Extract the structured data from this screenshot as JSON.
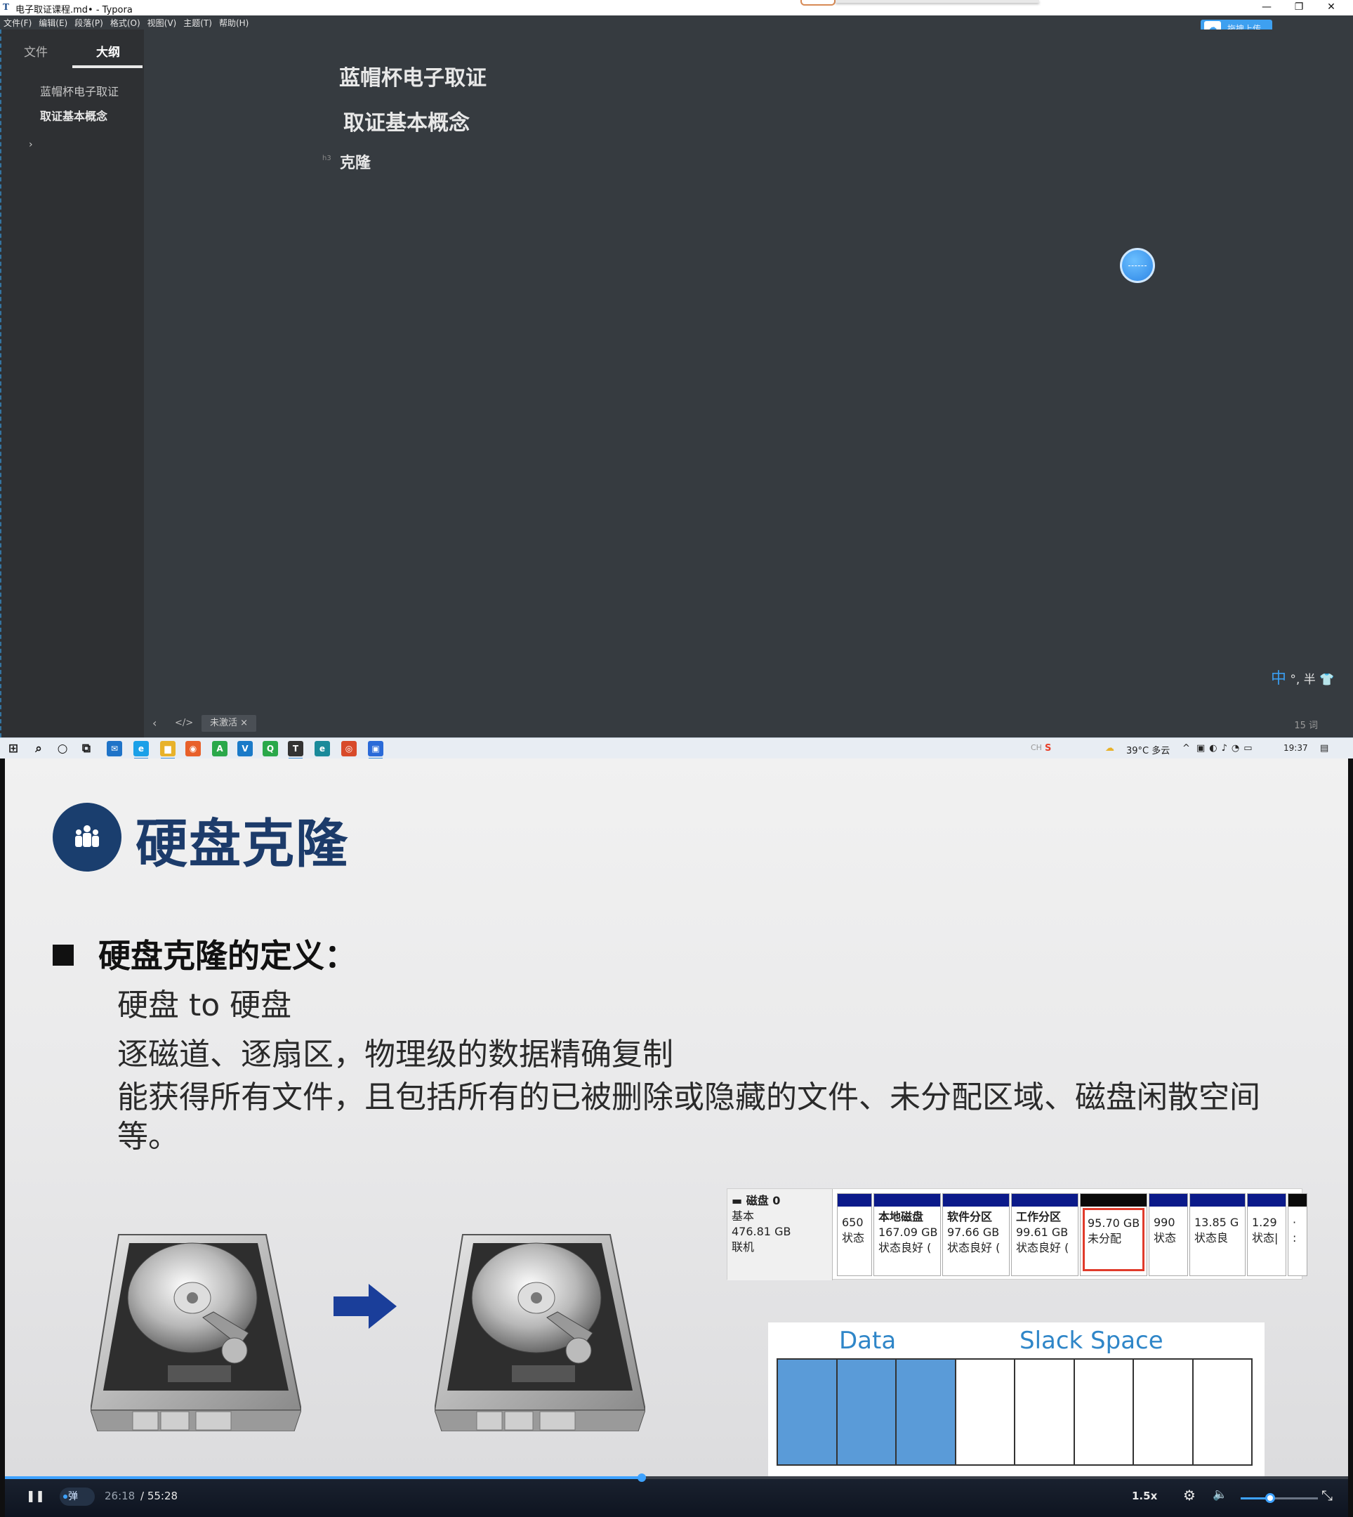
{
  "typora": {
    "window_title": "电子取证课程.md• - Typora",
    "controls": {
      "minimize": "—",
      "restore": "❐",
      "close": "✕"
    },
    "menu": [
      "文件(F)",
      "编辑(E)",
      "段落(P)",
      "格式(O)",
      "视图(V)",
      "主题(T)",
      "帮助(H)"
    ],
    "upload_label": "拖拽上传",
    "sidebar": {
      "tabs": [
        "文件",
        "大纲"
      ],
      "active_tab": "大纲",
      "outline": [
        "蓝帽杯电子取证",
        "取证基本概念"
      ],
      "expand_glyph": "›"
    },
    "editor": {
      "h1": "蓝帽杯电子取证",
      "h2": "取证基本概念",
      "h3": "克隆",
      "h3_marker": "h3"
    },
    "ime": {
      "mode": "中",
      "rest": "°, 半"
    },
    "statusbar": {
      "back_icon": "‹",
      "code_icon": "</>",
      "tag": "未激活 ×",
      "word_count": "15 词"
    }
  },
  "taskbar": {
    "apps": [
      {
        "name": "start",
        "glyph": "⊞",
        "color": "#1a1a1a"
      },
      {
        "name": "search",
        "glyph": "⌕",
        "color": "#1a1a1a"
      },
      {
        "name": "cortana",
        "glyph": "○",
        "color": "#1a1a1a"
      },
      {
        "name": "task-view",
        "glyph": "⧉",
        "color": "#1a1a1a"
      },
      {
        "name": "mail",
        "glyph": "✉",
        "color": "#1e73c8"
      },
      {
        "name": "edge-legacy",
        "glyph": "e",
        "color": "#1aa0e8"
      },
      {
        "name": "explorer",
        "glyph": "▆",
        "color": "#e8b22a"
      },
      {
        "name": "firefox",
        "glyph": "◉",
        "color": "#e8602a"
      },
      {
        "name": "app-a",
        "glyph": "A",
        "color": "#2aa84a"
      },
      {
        "name": "vmware",
        "glyph": "V",
        "color": "#1a7ac8"
      },
      {
        "name": "app-qc",
        "glyph": "Q",
        "color": "#2aa84a"
      },
      {
        "name": "typora",
        "glyph": "T",
        "color": "#333333"
      },
      {
        "name": "edge",
        "glyph": "e",
        "color": "#1a8a9a"
      },
      {
        "name": "chrome",
        "glyph": "◎",
        "color": "#d84a2a"
      },
      {
        "name": "player",
        "glyph": "▣",
        "color": "#2a6ad8"
      }
    ],
    "tray": {
      "weather": "39°C 多云",
      "time": "19:37",
      "lang_glyph": "CH",
      "sogou_glyph": "S"
    }
  },
  "slide": {
    "title": "硬盘克隆",
    "definition_heading": "硬盘克隆的定义：",
    "lines": [
      "硬盘 to 硬盘",
      "逐磁道、逐扇区，物理级的数据精确复制",
      "能获得所有文件，且包括所有的已被删除或隐藏的文件、未分配区域、磁盘闲散空间等。"
    ],
    "disk": {
      "name": "磁盘 0",
      "type": "基本",
      "size": "476.81 GB",
      "status": "联机",
      "partitions": [
        {
          "title": "",
          "line1": "650",
          "line2": "状态",
          "bar": "blue",
          "highlight": false
        },
        {
          "title": "本地磁盘",
          "line1": "167.09 GB",
          "line2": "状态良好 (",
          "bar": "blue",
          "highlight": false
        },
        {
          "title": "软件分区",
          "line1": "97.66 GB",
          "line2": "状态良好 (",
          "bar": "blue",
          "highlight": false
        },
        {
          "title": "工作分区",
          "line1": "99.61 GB",
          "line2": "状态良好 (",
          "bar": "blue",
          "highlight": false
        },
        {
          "title": "",
          "line1": "95.70 GB",
          "line2": "未分配",
          "bar": "black",
          "highlight": true
        },
        {
          "title": "",
          "line1": "990",
          "line2": "状态",
          "bar": "blue",
          "highlight": false
        },
        {
          "title": "",
          "line1": "13.85 G",
          "line2": "状态良",
          "bar": "blue",
          "highlight": false
        },
        {
          "title": "",
          "line1": "1.29",
          "line2": "状态|",
          "bar": "blue",
          "highlight": false
        },
        {
          "title": "",
          "line1": "·",
          "line2": ":",
          "bar": "black",
          "highlight": false
        }
      ]
    },
    "slack": {
      "data_label": "Data",
      "slack_label": "Slack Space",
      "filled_cells": 3,
      "total_cells": 8,
      "fill_color": "#5a9bd8"
    }
  },
  "player": {
    "play_pause_glyph": "❚❚",
    "danmu_label": "弹",
    "current_time": "26:18",
    "total_time": "/ 55:28",
    "progress": 0.474,
    "speed": "1.5x",
    "settings_glyph": "⚙",
    "volume_glyph": "🔈",
    "volume": 0.38,
    "fullscreen_glyph": "⤡"
  }
}
